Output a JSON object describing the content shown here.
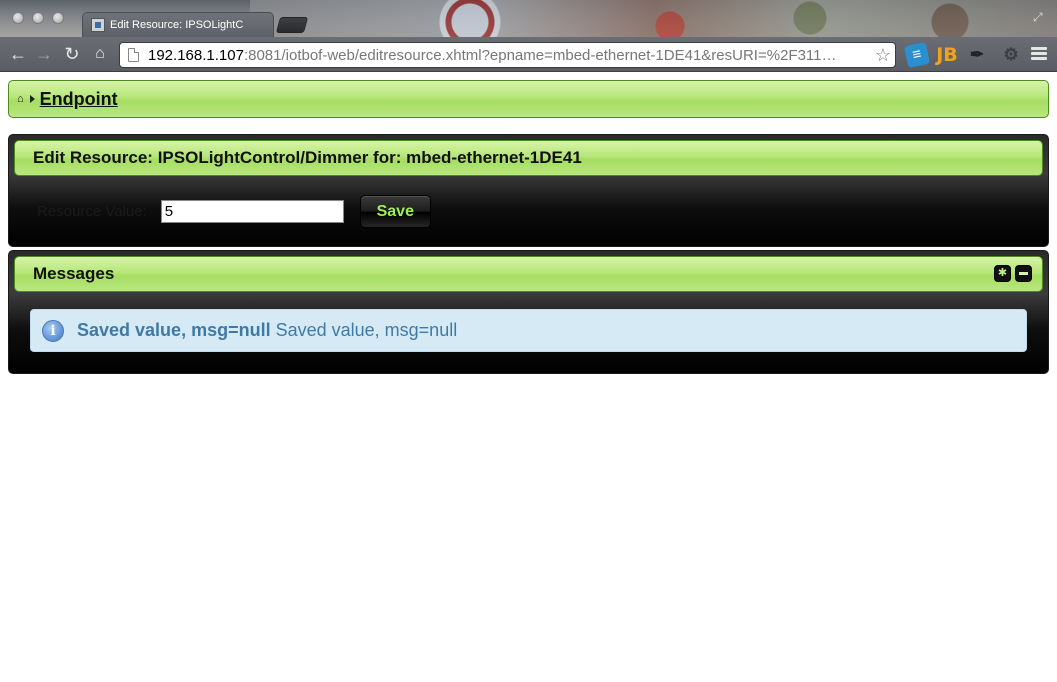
{
  "browser": {
    "tab_title": "Edit Resource: IPSOLightC",
    "url_host": "192.168.1.107",
    "url_rest": ":8081/iotbof-web/editresource.xhtml?epname=mbed-ethernet-1DE41&resURI=%2F311…",
    "extensions": [
      "openload-extension-icon",
      "jb-extension-icon",
      "dropper-extension-icon",
      "gear-extension-icon"
    ]
  },
  "breadcrumb": {
    "home_icon": "home-icon",
    "link_label": "Endpoint"
  },
  "edit_panel": {
    "title": "Edit Resource: IPSOLightControl/Dimmer for: mbed-ethernet-1DE41",
    "field_label": "Resource Value:",
    "field_value": "5",
    "save_label": "Save"
  },
  "messages_panel": {
    "title": "Messages",
    "message_summary": "Saved value, msg=null",
    "message_detail": "Saved value, msg=null",
    "accent": "#3e7aa6"
  },
  "colors": {
    "header_green": "#b7e67a",
    "panel_dark": "#0e0e0e",
    "info_bg": "#d6eaf6",
    "save_text": "#9ef05a"
  }
}
